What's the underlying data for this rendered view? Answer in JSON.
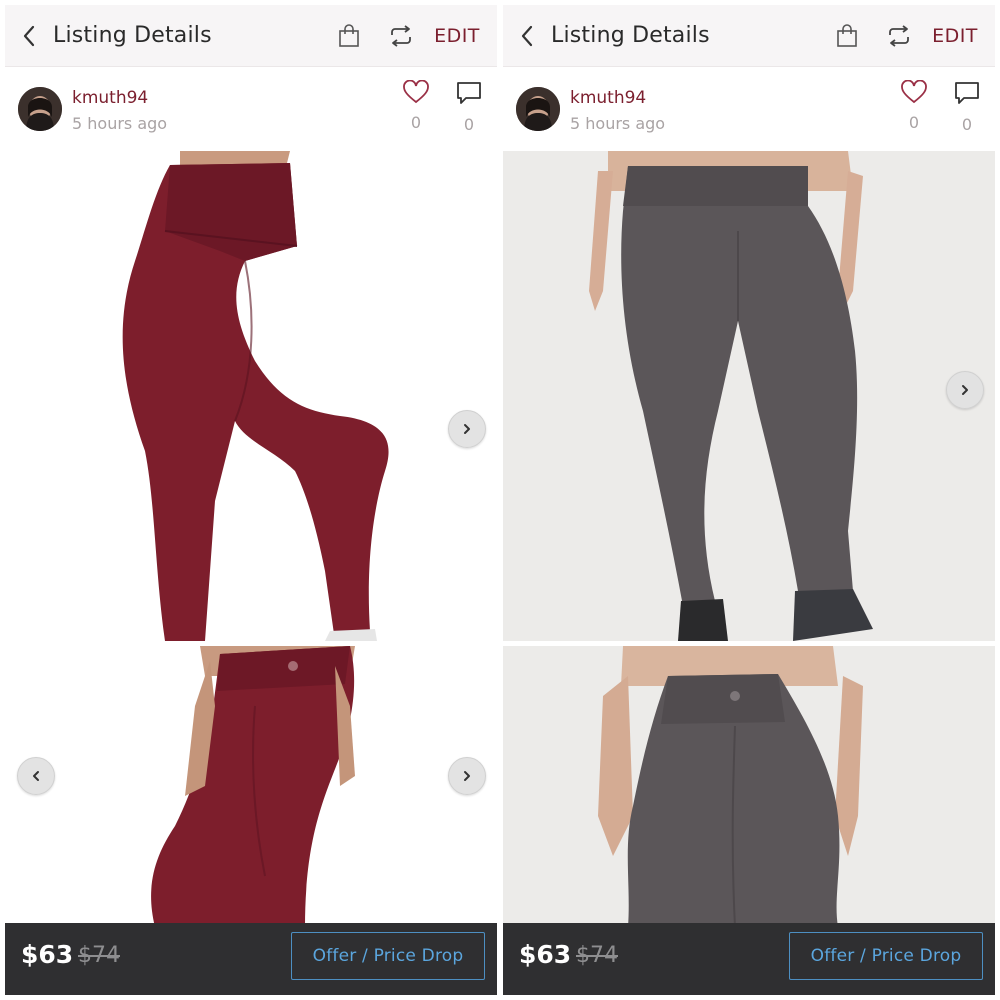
{
  "panels": [
    {
      "header": {
        "title": "Listing Details",
        "edit_label": "EDIT",
        "back_icon": "chevron-left-icon",
        "bag_icon": "shopping-bag-icon",
        "share_icon": "repeat-icon"
      },
      "seller": {
        "username": "kmuth94",
        "posted": "5 hours ago",
        "likes": "0",
        "comments": "0"
      },
      "photos": [
        {
          "description_icon": "leggings-photo",
          "color": "#7d1e2c"
        },
        {
          "description_icon": "leggings-back-photo",
          "color": "#7d1e2c"
        }
      ],
      "pricing": {
        "price": "$63",
        "original_price": "$74",
        "offer_button": "Offer / Price Drop"
      }
    },
    {
      "header": {
        "title": "Listing Details",
        "edit_label": "EDIT",
        "back_icon": "chevron-left-icon",
        "bag_icon": "shopping-bag-icon",
        "share_icon": "repeat-icon"
      },
      "seller": {
        "username": "kmuth94",
        "posted": "5 hours ago",
        "likes": "0",
        "comments": "0"
      },
      "photos": [
        {
          "description_icon": "leggings-photo",
          "color": "#5b5659"
        },
        {
          "description_icon": "leggings-back-photo",
          "color": "#5b5659"
        }
      ],
      "pricing": {
        "price": "$63",
        "original_price": "$74",
        "offer_button": "Offer / Price Drop"
      }
    }
  ],
  "colors": {
    "brand": "#7b1f2e",
    "offer_blue": "#5ba6de",
    "bar_dark": "#2f2f31"
  }
}
